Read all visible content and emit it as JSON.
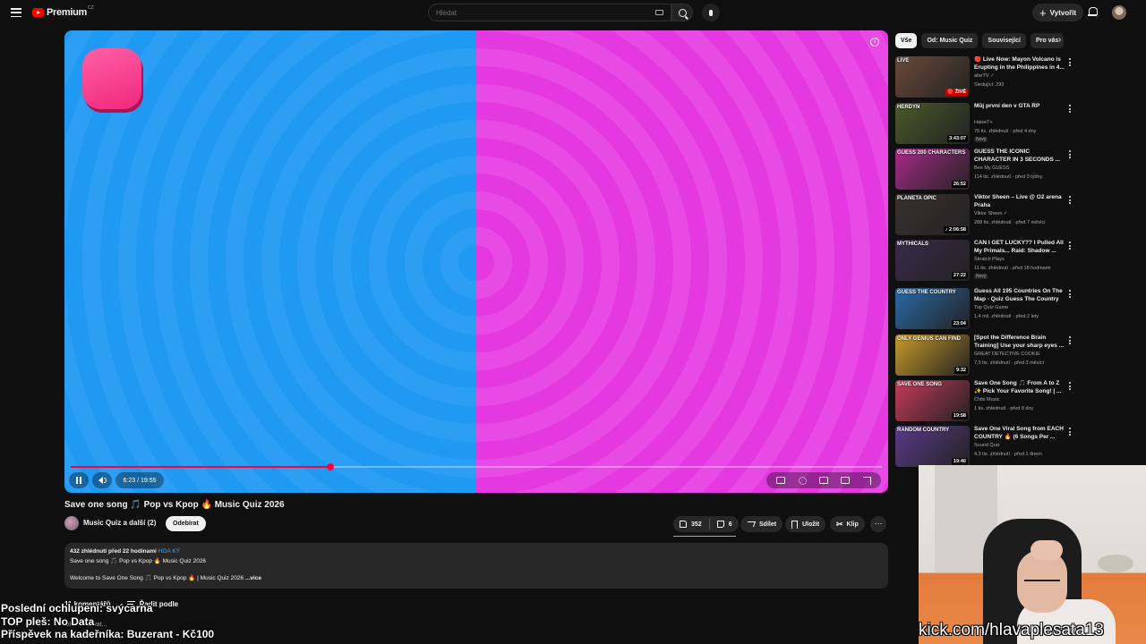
{
  "header": {
    "logo_text": "Premium",
    "logo_country": "CZ",
    "search_placeholder": "Hledat",
    "create_label": "Vytvořit"
  },
  "player": {
    "time": "6:23 / 19:55",
    "progress_fraction": 0.32,
    "left_color": "#2196f3",
    "right_color": "#e63fe2"
  },
  "video": {
    "title": "Save one song 🎵 Pop vs Kpop 🔥 Music Quiz 2026",
    "channel": "Music Quiz a další (2)",
    "subscribe_label": "Odebírat",
    "likes": "352",
    "dislikes": "6",
    "share_label": "Sdílet",
    "save_label": "Uložit",
    "clip_label": "Klip",
    "more_label": "⋯"
  },
  "description": {
    "meta": "432 zhlédnutí  před 22 hodinami",
    "hashtag": "HOA KÝ",
    "line1": "Save one song 🎵 Pop vs Kpop 🔥 Music Quiz 2026",
    "line2": "Welcome to Save One Song 🎵 Pop vs Kpop 🔥 | Music Quiz 2026",
    "more": "...více"
  },
  "comments": {
    "count_label": "11 komentářů",
    "sort_label": "Řadit podle",
    "add_placeholder": "Okomentovat..."
  },
  "overlay": {
    "line1": "Poslední ochlupení: svýcarna",
    "line2": "TOP pleš: No Data",
    "line3": "Příspěvek na kadeřníka: Buzerant - Kč100",
    "kick": "kick.com/hlavaplesata13"
  },
  "sidebar": {
    "chips": [
      "Vše",
      "Od: Music Quiz",
      "Související",
      "Pro vás"
    ],
    "items": [
      {
        "title": "🔴 Live Now: Mayon Volcano is Erupting in the Philippines in 4...",
        "channel": "afarTV ✓",
        "meta": "Sledující: 293",
        "badge_text": "🔴 ŽIVĚ",
        "thumb_label": "LIVE",
        "badge": "",
        "thumb_color": "#6b4a3a",
        "live": true
      },
      {
        "title": "Můj první den v GTA RP",
        "channel": "HaiseT+",
        "meta": "76 tis. zhlédnutí · před 4 dny",
        "badge_text": "3:43:07",
        "thumb_label": "HERDYN",
        "badge": "Nový",
        "thumb_color": "#4a5a2a"
      },
      {
        "title": "GUESS THE ICONIC CHARACTER IN 3 SECONDS ...",
        "channel": "Bee My GUESS",
        "meta": "114 tis. zhlédnutí · před 3 týdny",
        "badge_text": "26:52",
        "thumb_label": "GUESS 200 CHARACTERS",
        "badge": "",
        "thumb_color": "#a82a8a"
      },
      {
        "title": "Viktor Sheen – Live @ O2 arena Praha",
        "channel": "Viktor Sheen ✓",
        "meta": "288 tis. zhlédnutí · před 7 měsíci",
        "badge_text": "♪ 2:06:58",
        "thumb_label": "PLANETA OPIC",
        "badge": "",
        "thumb_color": "#3a3030"
      },
      {
        "title": "CAN I GET LUCKY?? I Pulled All My Primals... Raid: Shadow ...",
        "channel": "Skratch Plays",
        "meta": "11 tis. zhlédnutí · před 18 hodinami",
        "badge_text": "27:22",
        "thumb_label": "MYTHICALS",
        "badge": "Nový",
        "thumb_color": "#3a2a4a"
      },
      {
        "title": "Guess All 195 Countries On The Map - Quiz Guess The Country",
        "channel": "Top Quiz Game",
        "meta": "1,4 mil. zhlédnutí · před 2 lety",
        "badge_text": "23:04",
        "thumb_label": "GUESS THE COUNTRY",
        "badge": "",
        "thumb_color": "#2a6aa8"
      },
      {
        "title": "[Spot the Difference Brain Training] Use your sharp eyes ...",
        "channel": "GREAT DETECTIVE COOKIE",
        "meta": "7,5 tis. zhlédnutí · před 3 měsíci",
        "badge_text": "9:32",
        "thumb_label": "ONLY GENIUS CAN FIND",
        "badge": "",
        "thumb_color": "#c89a2a"
      },
      {
        "title": "Save One Song 🎵 From A to Z ✨ Pick Your Favorite Song! | ...",
        "channel": "Chibi Music",
        "meta": "1 tis. zhlédnutí · před 8 dny",
        "badge_text": "19:58",
        "thumb_label": "SAVE ONE SONG",
        "badge": "",
        "thumb_color": "#c83a5a"
      },
      {
        "title": "Save One Viral Song from EACH COUNTRY 🔥 (6 Songs Per ...",
        "channel": "Sound Quiz",
        "meta": "4,3 tis. zhlédnutí · před 1 dnem",
        "badge_text": "19:40",
        "thumb_label": "RANDOM COUNTRY",
        "badge": "",
        "thumb_color": "#5a3a8a"
      }
    ]
  }
}
